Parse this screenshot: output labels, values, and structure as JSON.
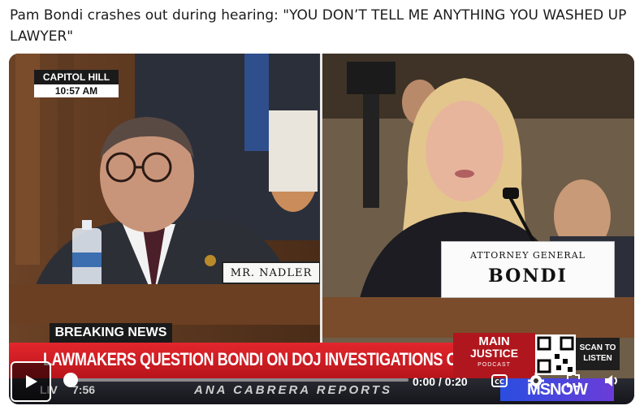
{
  "post": {
    "title": "Pam Bondi crashes out during hearing: \"YOU DON’T TELL ME ANYTHING YOU WASHED UP LAWYER\""
  },
  "video": {
    "location": "CAPITOL HILL",
    "clock": "10:57 AM",
    "nameplate_left": "MR. NADLER",
    "nameplate_right_title": "ATTORNEY GENERAL",
    "nameplate_right_name": "BONDI",
    "breaking_label": "BREAKING NEWS",
    "headline": "LAWMAKERS QUESTION BONDI ON DOJ INVESTIGATIONS OF DEMS",
    "promo_line1": "MAIN",
    "promo_line2": "JUSTICE",
    "promo_line3": "PODCAST",
    "scan_label": "SCAN TO LISTEN",
    "ticker_live": "LIV",
    "ticker_time": "7:56",
    "ticker_show": "ANA CABRERA REPORTS",
    "network": "MSNOW"
  },
  "player": {
    "current_time": "0:00",
    "duration": "0:20",
    "timecode": "0:00 / 0:20",
    "progress": 0,
    "icons": [
      "play-icon",
      "captions-icon",
      "settings-icon",
      "fullscreen-icon",
      "volume-icon"
    ]
  }
}
